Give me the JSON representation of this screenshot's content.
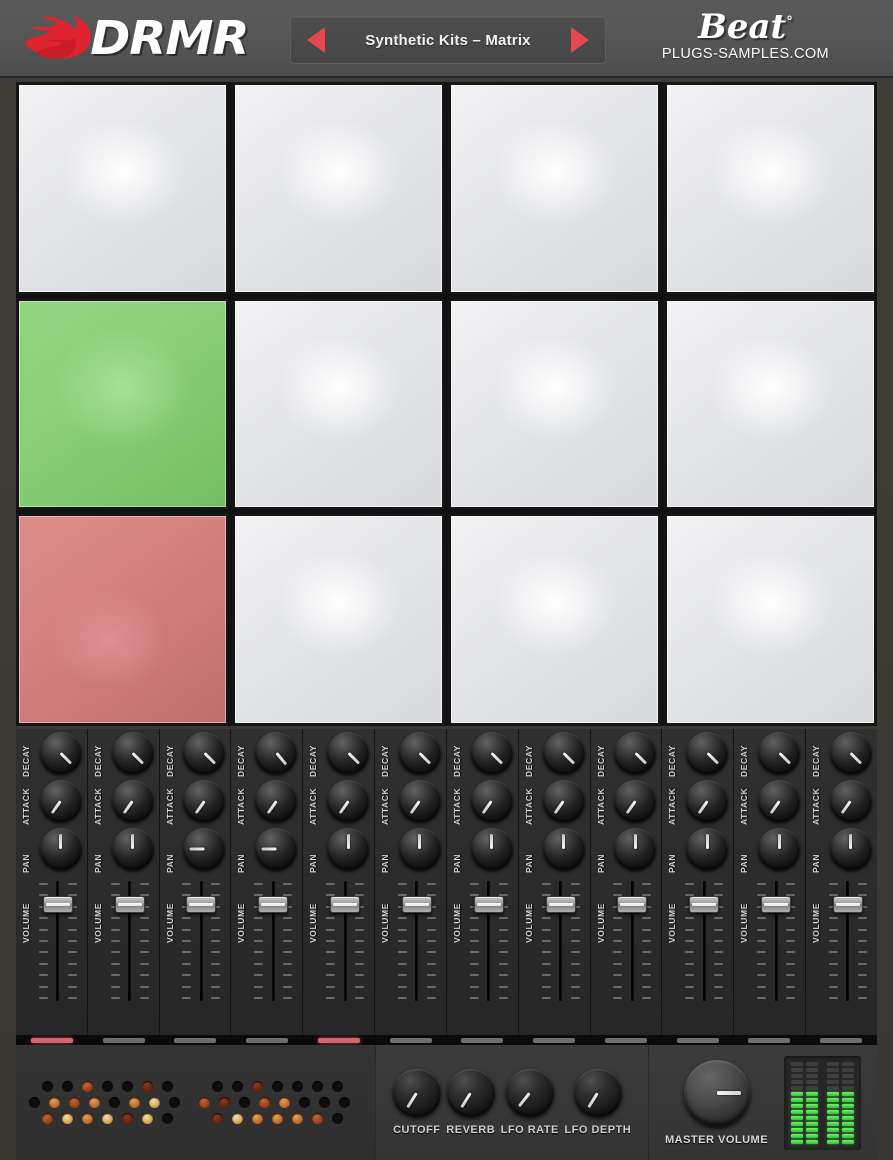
{
  "app": {
    "title": "DRMR",
    "logo_icon": "flame-icon"
  },
  "header": {
    "kit_selector": {
      "prev_icon": "arrow-left-icon",
      "next_icon": "arrow-right-icon",
      "value": "Synthetic Kits – Matrix"
    },
    "brand": {
      "name": "Beat",
      "degree": "°",
      "website": "PLUGS-SAMPLES.COM"
    }
  },
  "pads": [
    {
      "index": 1,
      "state": "idle",
      "color": "#e6e7ea"
    },
    {
      "index": 2,
      "state": "idle",
      "color": "#e6e7ea"
    },
    {
      "index": 3,
      "state": "idle",
      "color": "#e6e7ea"
    },
    {
      "index": 4,
      "state": "idle",
      "color": "#e6e7ea"
    },
    {
      "index": 5,
      "state": "selected",
      "color": "#8bcf79"
    },
    {
      "index": 6,
      "state": "idle",
      "color": "#e6e7ea"
    },
    {
      "index": 7,
      "state": "idle",
      "color": "#e6e7ea"
    },
    {
      "index": 8,
      "state": "idle",
      "color": "#e6e7ea"
    },
    {
      "index": 9,
      "state": "active",
      "color": "#d48080"
    },
    {
      "index": 10,
      "state": "idle",
      "color": "#e6e7ea"
    },
    {
      "index": 11,
      "state": "idle",
      "color": "#e6e7ea"
    },
    {
      "index": 12,
      "state": "idle",
      "color": "#e6e7ea"
    }
  ],
  "mixer": {
    "knob_labels": {
      "decay": "DECAY",
      "attack": "ATTACK",
      "pan": "PAN"
    },
    "fader_label": "VOLUME",
    "fader_tick_count": 11,
    "channels": [
      {
        "index": 1,
        "decay": 135,
        "attack": 215,
        "pan": 0,
        "volume": 86,
        "led": "on"
      },
      {
        "index": 2,
        "decay": 135,
        "attack": 215,
        "pan": 0,
        "volume": 86,
        "led": "off"
      },
      {
        "index": 3,
        "decay": 135,
        "attack": 215,
        "pan": -90,
        "volume": 86,
        "led": "off"
      },
      {
        "index": 4,
        "decay": 140,
        "attack": 215,
        "pan": -90,
        "volume": 86,
        "led": "off"
      },
      {
        "index": 5,
        "decay": 135,
        "attack": 215,
        "pan": 0,
        "volume": 86,
        "led": "on"
      },
      {
        "index": 6,
        "decay": 135,
        "attack": 215,
        "pan": 0,
        "volume": 86,
        "led": "off"
      },
      {
        "index": 7,
        "decay": 135,
        "attack": 215,
        "pan": 0,
        "volume": 86,
        "led": "off"
      },
      {
        "index": 8,
        "decay": 135,
        "attack": 215,
        "pan": 0,
        "volume": 86,
        "led": "off"
      },
      {
        "index": 9,
        "decay": 135,
        "attack": 215,
        "pan": 0,
        "volume": 86,
        "led": "off"
      },
      {
        "index": 10,
        "decay": 135,
        "attack": 215,
        "pan": 0,
        "volume": 86,
        "led": "off"
      },
      {
        "index": 11,
        "decay": 135,
        "attack": 215,
        "pan": 0,
        "volume": 86,
        "led": "off"
      },
      {
        "index": 12,
        "decay": 135,
        "attack": 215,
        "pan": 0,
        "volume": 86,
        "led": "off"
      }
    ]
  },
  "bottom": {
    "grille": {
      "icon": "speaker-grille-icon"
    },
    "fx": [
      {
        "label": "CUTOFF",
        "angle": 212
      },
      {
        "label": "REVERB",
        "angle": 212
      },
      {
        "label": "LFO RATE",
        "angle": 218
      },
      {
        "label": "LFO DEPTH",
        "angle": 212
      }
    ],
    "master": {
      "label": "MASTER VOLUME",
      "angle": 90
    },
    "meters": {
      "segment_count": 14,
      "columns": [
        {
          "lit": 9
        },
        {
          "lit": 9
        },
        {
          "lit": 9
        },
        {
          "lit": 9
        }
      ]
    }
  },
  "colors": {
    "accent_red": "#e8474f",
    "pad_green": "#8bcf79",
    "pad_red": "#d48080",
    "meter_green": "#4ad24a",
    "panel_dark": "#2b2b2b",
    "header_gray": "#565656"
  }
}
